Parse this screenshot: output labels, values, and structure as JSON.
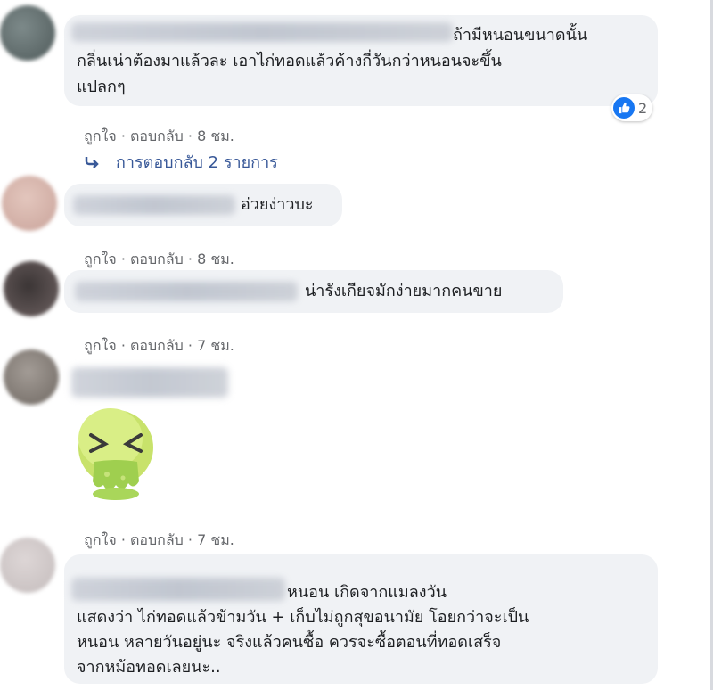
{
  "comments": [
    {
      "text_lines": [
        "ถ้ามีหนอนขนาดนั้น",
        "กลิ่นเน่าต้องมาแล้วละ เอาไก่ทอดแล้วค้างกี่วันกว่าหนอนจะขึ้น",
        "แปลกๆ"
      ],
      "like": "ถูกใจ",
      "reply": "ตอบกลับ",
      "time": "8 ชม.",
      "reaction_count": "2"
    },
    {
      "text_lines": [
        "อ่วยง่าวบะ"
      ],
      "like": "ถูกใจ",
      "reply": "ตอบกลับ",
      "time": "8 ชม."
    },
    {
      "text_lines": [
        "น่ารังเกียจมักง่ายมากคนขาย"
      ],
      "like": "ถูกใจ",
      "reply": "ตอบกลับ",
      "time": "7 ชม."
    },
    {
      "like": "ถูกใจ",
      "reply": "ตอบกลับ",
      "time": "7 ชม."
    },
    {
      "text_lines": [
        "หนอน เกิดจากแมลงวัน",
        "แสดงว่า ไก่ทอดแล้วข้ามวัน + เก็บไม่ถูกสุขอนามัย โอยกว่าจะเป็น",
        "หนอน หลายวันอยู่นะ จริงแล้วคนซื้อ ควรจะซื้อตอนที่ทอดเสร็จ",
        "จากหม้อทอดเลยนะ.."
      ]
    }
  ],
  "replies_link": "การตอบกลับ 2 รายการ",
  "colors": {
    "link": "#385898",
    "bubble": "#f0f2f5",
    "like_badge": "#1877f2",
    "meta": "#65676b"
  },
  "icons": {
    "reaction": "thumbs-up-icon",
    "reply_arrow": "reply-arrow-icon",
    "sticker": "vomit-sticker-icon"
  }
}
